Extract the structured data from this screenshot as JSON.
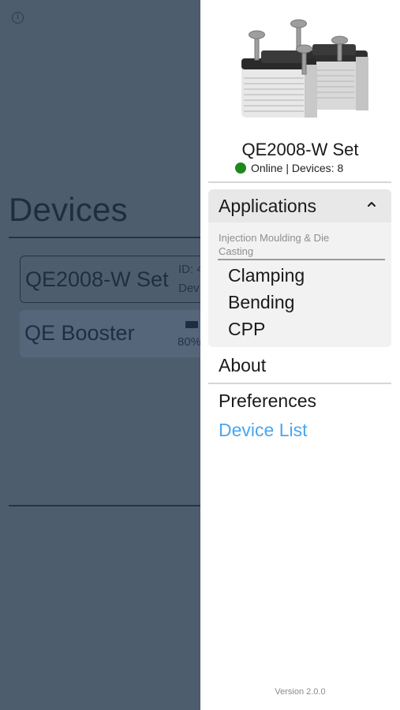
{
  "background": {
    "title": "Devices",
    "devices": [
      {
        "name": "QE2008-W Set",
        "meta1": "ID: 4",
        "meta2": "Dev"
      },
      {
        "name": "QE Booster",
        "meta1": "",
        "meta2": "80%"
      }
    ]
  },
  "drawer": {
    "device_name": "QE2008-W Set",
    "status": "Online | Devices: 8",
    "status_color": "#1c8a1c",
    "applications": {
      "label": "Applications",
      "group_label": "Injection Moulding & Die Casting",
      "items": [
        "Clamping",
        "Bending",
        "CPP"
      ]
    },
    "menu": {
      "about": "About",
      "preferences": "Preferences",
      "device_list": "Device List"
    },
    "link_color": "#4aa6ee",
    "version": "Version 2.0.0"
  }
}
